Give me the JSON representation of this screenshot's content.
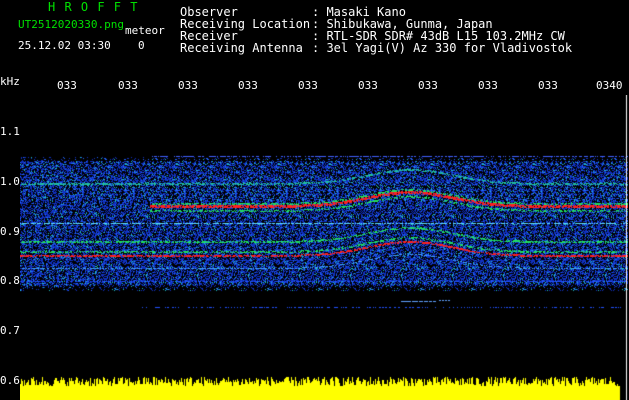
{
  "header": {
    "logo": "H R O F F T",
    "filename": "UT2512020330.png",
    "type": "meteor",
    "datetime": "25.12.02 03:30",
    "count": "0",
    "labels": [
      "Observer",
      "Receiving Location",
      "Receiver",
      "Receiving Antenna"
    ],
    "values": [
      ": Masaki Kano",
      ": Shibukawa, Gunma, Japan",
      ": RTL-SDR SDR# 43dB L15 103.2MHz CW",
      ": 3el Yagi(V) Az 330 for Vladivostok"
    ]
  },
  "axes": {
    "y_unit": "kHz",
    "y_ticks": [
      "1.1",
      "1.0",
      "0.9",
      "0.8",
      "0.7",
      "0.6"
    ],
    "x_ticks": [
      "033",
      "033",
      "033",
      "033",
      "033",
      "033",
      "033",
      "033",
      "033",
      "0340"
    ]
  },
  "colors": {
    "green": "#00e000",
    "background": "#000000",
    "noise": "#1030c0",
    "echo": "#ff2020",
    "spectrum": "#ffff00"
  }
}
